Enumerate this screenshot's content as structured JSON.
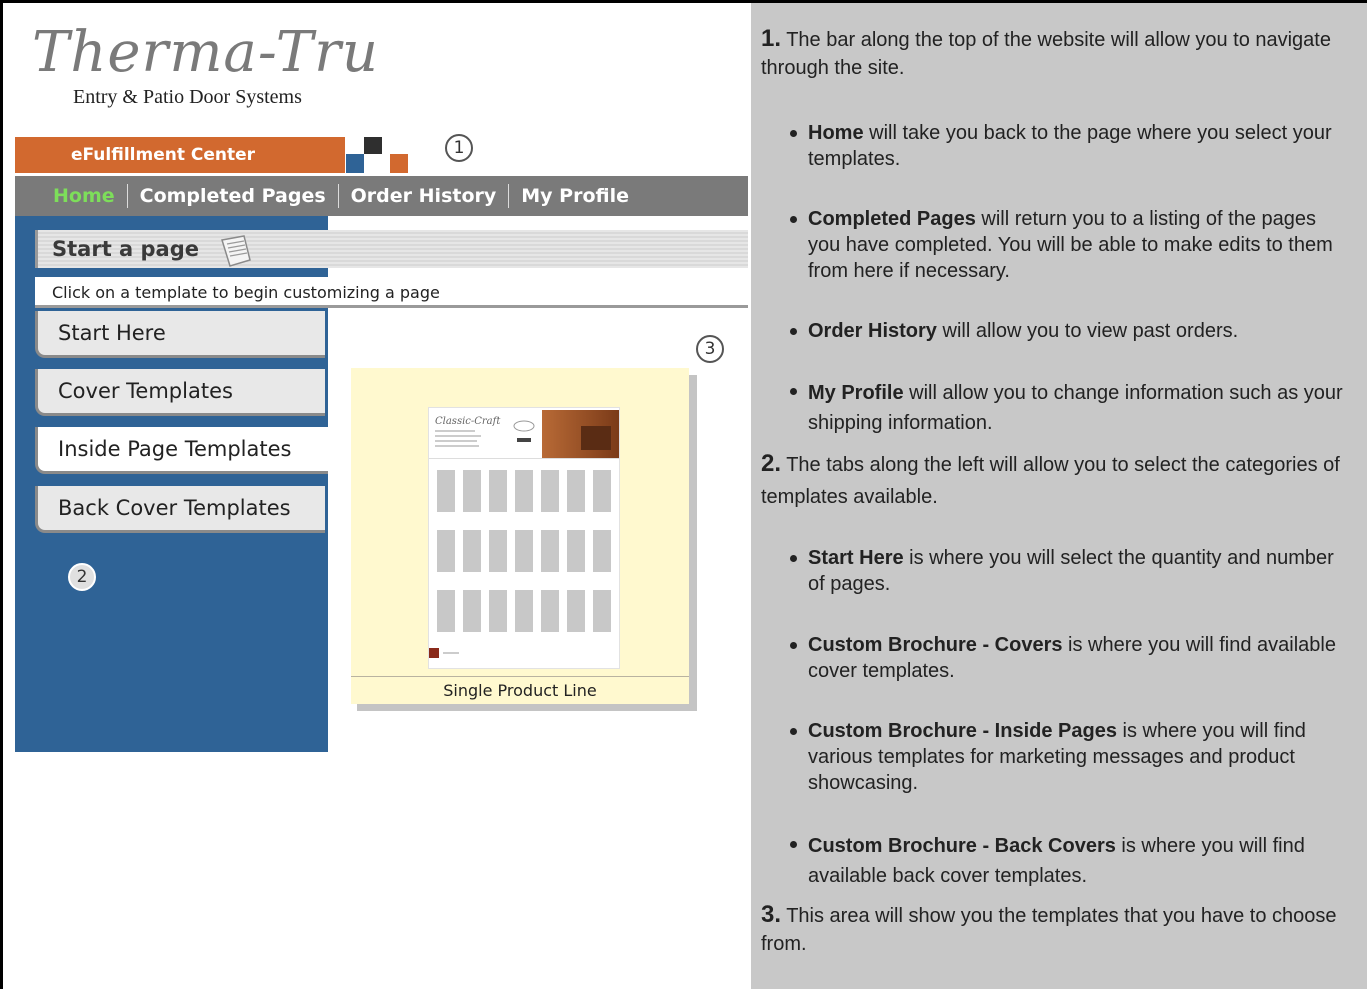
{
  "logo": {
    "script": "Therma-Tru",
    "subtitle": "Entry & Patio Door Systems"
  },
  "efc": {
    "title": "eFulfillment Center"
  },
  "callouts": {
    "one": "1",
    "two": "2",
    "three": "3"
  },
  "nav": {
    "home": "Home",
    "completed": "Completed Pages",
    "history": "Order History",
    "profile": "My Profile"
  },
  "start": {
    "heading": "Start a page",
    "instruction": "Click on a template to begin customizing a page"
  },
  "tabs": [
    "Start Here",
    "Cover Templates",
    "Inside Page Templates",
    "Back Cover Templates"
  ],
  "template": {
    "label": "Single Product Line",
    "thumb_title": "Classic-Craft"
  },
  "help": {
    "p1_num": "1.",
    "p1_text": " The bar along the top of the website will allow you to navigate through the site.",
    "b1": [
      {
        "bold": "Home",
        "text": " will take you back to the page where you select your templates."
      },
      {
        "bold": "Completed Pages",
        "text": " will return you to a listing of the pages you have completed. You will be able to make edits to them from here if necessary."
      },
      {
        "bold": "Order History",
        "text": " will allow you to view past orders."
      },
      {
        "bold": "My Profile",
        "text": " will allow you to change information such as your shipping information."
      }
    ],
    "p2_num": "2.",
    "p2_text": " The tabs along the left will allow you to select the categories of templates available.",
    "b2": [
      {
        "bold": "Start Here",
        "text": " is where you will select the quantity and number of pages."
      },
      {
        "bold": "Custom Brochure - Covers",
        "text": " is where you will find available cover templates."
      },
      {
        "bold": "Custom Brochure - Inside Pages",
        "text": " is where you will find various templates for marketing messages and product showcasing."
      },
      {
        "bold": "Custom Brochure - Back Covers",
        "text": " is where you will find available back cover templates."
      }
    ],
    "p3_num": "3.",
    "p3_text": " This area will show you the templates that you have to choose from."
  },
  "colors": {
    "orange": "#d2692f",
    "blue": "#2f6396",
    "nav_gray": "#7a7a7a",
    "home_green": "#7dde5a",
    "help_bg": "#c8c8c8",
    "card_bg": "#fff9cf"
  }
}
